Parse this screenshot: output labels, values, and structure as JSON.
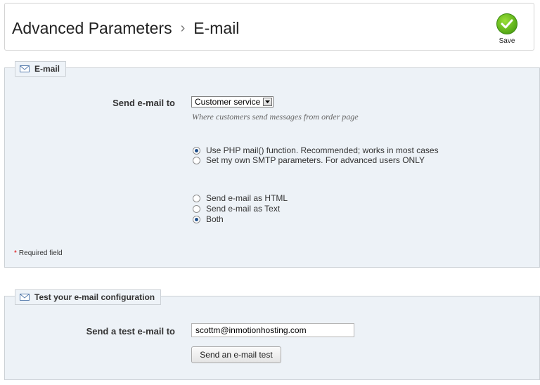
{
  "header": {
    "breadcrumb_parent": "Advanced Parameters",
    "breadcrumb_separator": "›",
    "page_title": "E-mail",
    "save_label": "Save"
  },
  "email_panel": {
    "legend": "E-mail",
    "send_to_label": "Send e-mail to",
    "send_to_selected": "Customer service",
    "send_to_hint": "Where customers send messages from order page",
    "method_options": [
      {
        "label": "Use PHP mail() function. Recommended; works in most cases",
        "checked": true
      },
      {
        "label": "Set my own SMTP parameters. For advanced users ONLY",
        "checked": false
      }
    ],
    "format_options": [
      {
        "label": "Send e-mail as HTML",
        "checked": false
      },
      {
        "label": "Send e-mail as Text",
        "checked": false
      },
      {
        "label": "Both",
        "checked": true
      }
    ],
    "required_star": "*",
    "required_text": "Required field"
  },
  "test_panel": {
    "legend": "Test your e-mail configuration",
    "send_test_label": "Send a test e-mail to",
    "test_email_value": "scottm@inmotionhosting.com",
    "send_test_button": "Send an e-mail test"
  },
  "colors": {
    "panel_bg": "#edf2f7",
    "save_green": "#5fb21a",
    "required_star": "#dd0000"
  }
}
